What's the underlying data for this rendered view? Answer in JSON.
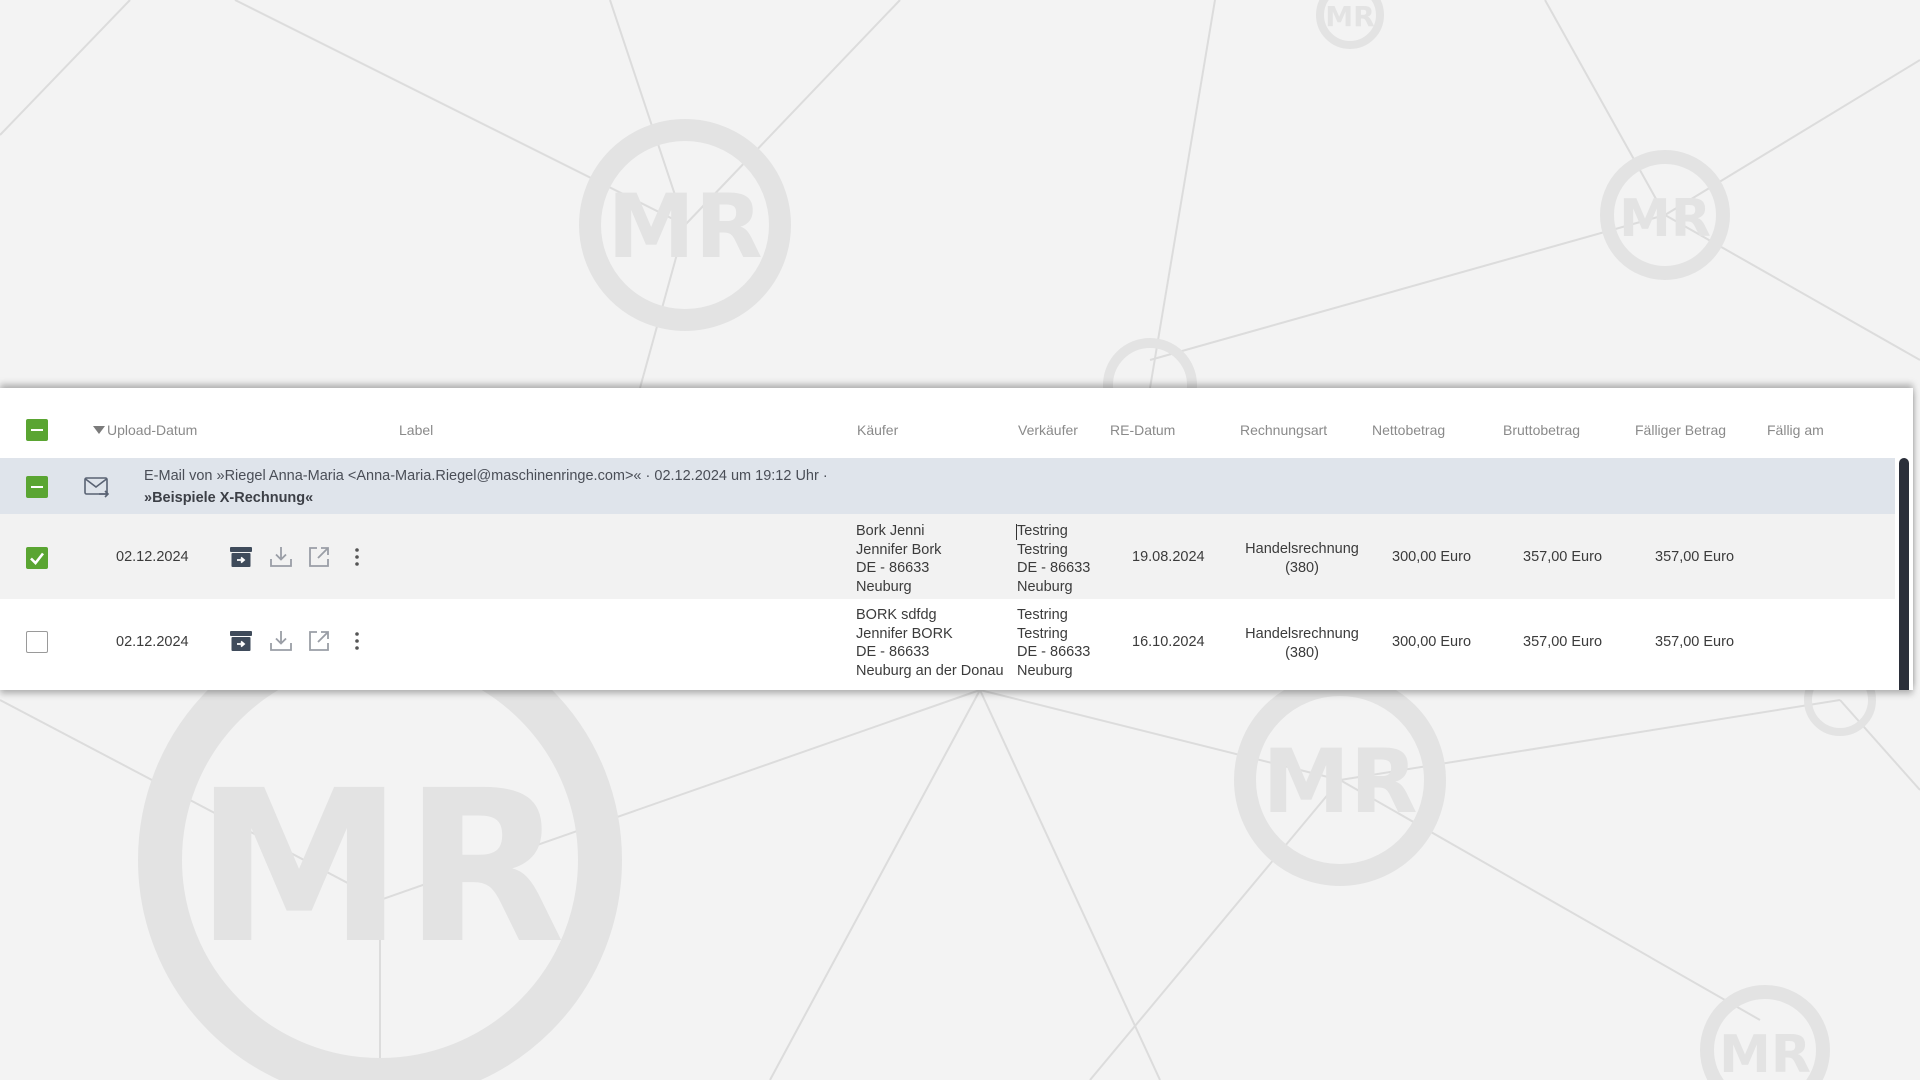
{
  "background": {
    "logo_text": "MR",
    "colors": {
      "bg": "#f3f3f3",
      "lines": "#dedede",
      "logo": "#e3e3e3"
    }
  },
  "colors": {
    "accent": "#5aa532",
    "group_bg": "#dfe4eb",
    "row_alt_bg": "#f2f2f2",
    "icon": "#3f4b5b",
    "scrollbar": "#2b2f3a"
  },
  "table": {
    "headers": {
      "upload_date": "Upload-Datum",
      "label": "Label",
      "buyer": "Käufer",
      "seller": "Verkäufer",
      "re_date": "RE-Datum",
      "invoice_type": "Rechnungsart",
      "net": "Nettobetrag",
      "gross": "Bruttobetrag",
      "due_amount": "Fälliger Betrag",
      "due_on": "Fällig am"
    },
    "group": {
      "line1": "E-Mail von »Riegel Anna-Maria <Anna-Maria.Riegel@maschinenringe.com>« · 02.12.2024 um 19:12 Uhr ·",
      "line2": "»Beispiele X-Rechnung«"
    },
    "rows": [
      {
        "selected": true,
        "upload_date": "02.12.2024",
        "buyer": [
          "Bork Jenni",
          "Jennifer Bork",
          "DE - 86633",
          "Neuburg"
        ],
        "seller": [
          "Testring",
          "Testring",
          "DE - 86633",
          "Neuburg"
        ],
        "re_date": "19.08.2024",
        "invoice_type": [
          "Handelsrechnung",
          "(380)"
        ],
        "net": "300,00 Euro",
        "gross": "357,00 Euro",
        "due_amount": "357,00 Euro",
        "due_on": ""
      },
      {
        "selected": false,
        "upload_date": "02.12.2024",
        "buyer": [
          "BORK sdfdg",
          "Jennifer BORK",
          "DE - 86633",
          "Neuburg an der Donau"
        ],
        "seller": [
          "Testring",
          "Testring",
          "DE - 86633",
          "Neuburg"
        ],
        "re_date": "16.10.2024",
        "invoice_type": [
          "Handelsrechnung",
          "(380)"
        ],
        "net": "300,00 Euro",
        "gross": "357,00 Euro",
        "due_amount": "357,00 Euro",
        "due_on": ""
      }
    ],
    "row_actions": [
      "archive-icon",
      "download-icon",
      "open-external-icon",
      "more-vertical-icon"
    ]
  }
}
